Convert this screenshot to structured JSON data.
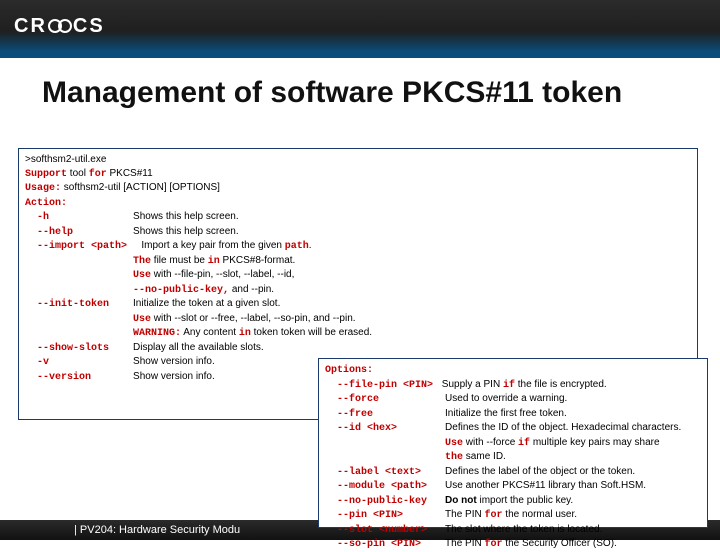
{
  "header": {
    "logo_text": "CR   CS"
  },
  "title": "Management of software PKCS#11 token",
  "box1": {
    "l1": ">softhsm2-util.exe",
    "l2_a": "Support",
    "l2_b": " tool ",
    "l2_c": "for",
    "l2_d": " PKCS#11",
    "l3_a": "Usage:",
    "l3_b": " softhsm2-util [ACTION] [OPTIONS]",
    "l4": "Action:",
    "l5_a": "  -h              ",
    "l5_b": "Shows this help screen.",
    "l6_a": "  --help          ",
    "l6_b": "Shows this help screen.",
    "l7_a": "  --import <path> ",
    "l7_b": "   Import a key pair from the given ",
    "l7_c": "path",
    "l7_d": ".",
    "l8_a": "                  The",
    "l8_b": " file must be ",
    "l8_c": "in",
    "l8_d": " PKCS#8-format.",
    "l9_a": "                  Use",
    "l9_b": " with --file-pin, --slot, --label, --id,",
    "l10_a": "                  --no-public-key,",
    "l10_b": " and --pin.",
    "l11_a": "  --init-token    ",
    "l11_b": "Initialize the token at a given slot.",
    "l12_a": "                  Use",
    "l12_b": " with --slot or --free, --label, --so-pin, and --pin.",
    "l13_a": "                  WARNING:",
    "l13_b": " Any content ",
    "l13_c": "in",
    "l13_d": " token token will be erased.",
    "l14_a": "  --show-slots    ",
    "l14_b": "Display all the available slots.",
    "l15_a": "  -v              ",
    "l15_b": "Show version info.",
    "l16_a": "  --version       ",
    "l16_b": "Show version info."
  },
  "box2": {
    "l1": "Options:",
    "l2_a": "  --file-pin <PIN> ",
    "l2_b": " Supply a PIN ",
    "l2_c": "if",
    "l2_d": " the file is encrypted.",
    "l3_a": "  --force           ",
    "l3_b": "Used to override a warning.",
    "l4_a": "  --free            ",
    "l4_b": "Initialize the first free token.",
    "l5_a": "  --id <hex>        ",
    "l5_b": "Defines the ID of the object. Hexadecimal characters.",
    "l6_a": "                    Use",
    "l6_b": " with --force ",
    "l6_c": "if",
    "l6_d": " multiple key pairs may share",
    "l7_a": "                    the",
    "l7_b": " same ID.",
    "l8_a": "  --label <text>    ",
    "l8_b": "Defines the label of the object or the token.",
    "l9_a": "  --module <path>   ",
    "l9_b": "Use another PKCS#11 library than Soft.HSM.",
    "l10_a": "  --no-public-key   ",
    "l10_b": "Do not",
    "l10_c": " import the public key.",
    "l11_a": "  --pin <PIN>       ",
    "l11_b": "The PIN ",
    "l11_c": "for",
    "l11_d": " the normal user.",
    "l12_a": "  --slot <number>   ",
    "l12_b": "The slot where the token is located.",
    "l13_a": "  --so-pin <PIN>    ",
    "l13_b": "The PIN ",
    "l13_c": "for",
    "l13_d": " the Security Officer (SO)."
  },
  "footer": {
    "text": "| PV204: Hardware Security Modu"
  }
}
